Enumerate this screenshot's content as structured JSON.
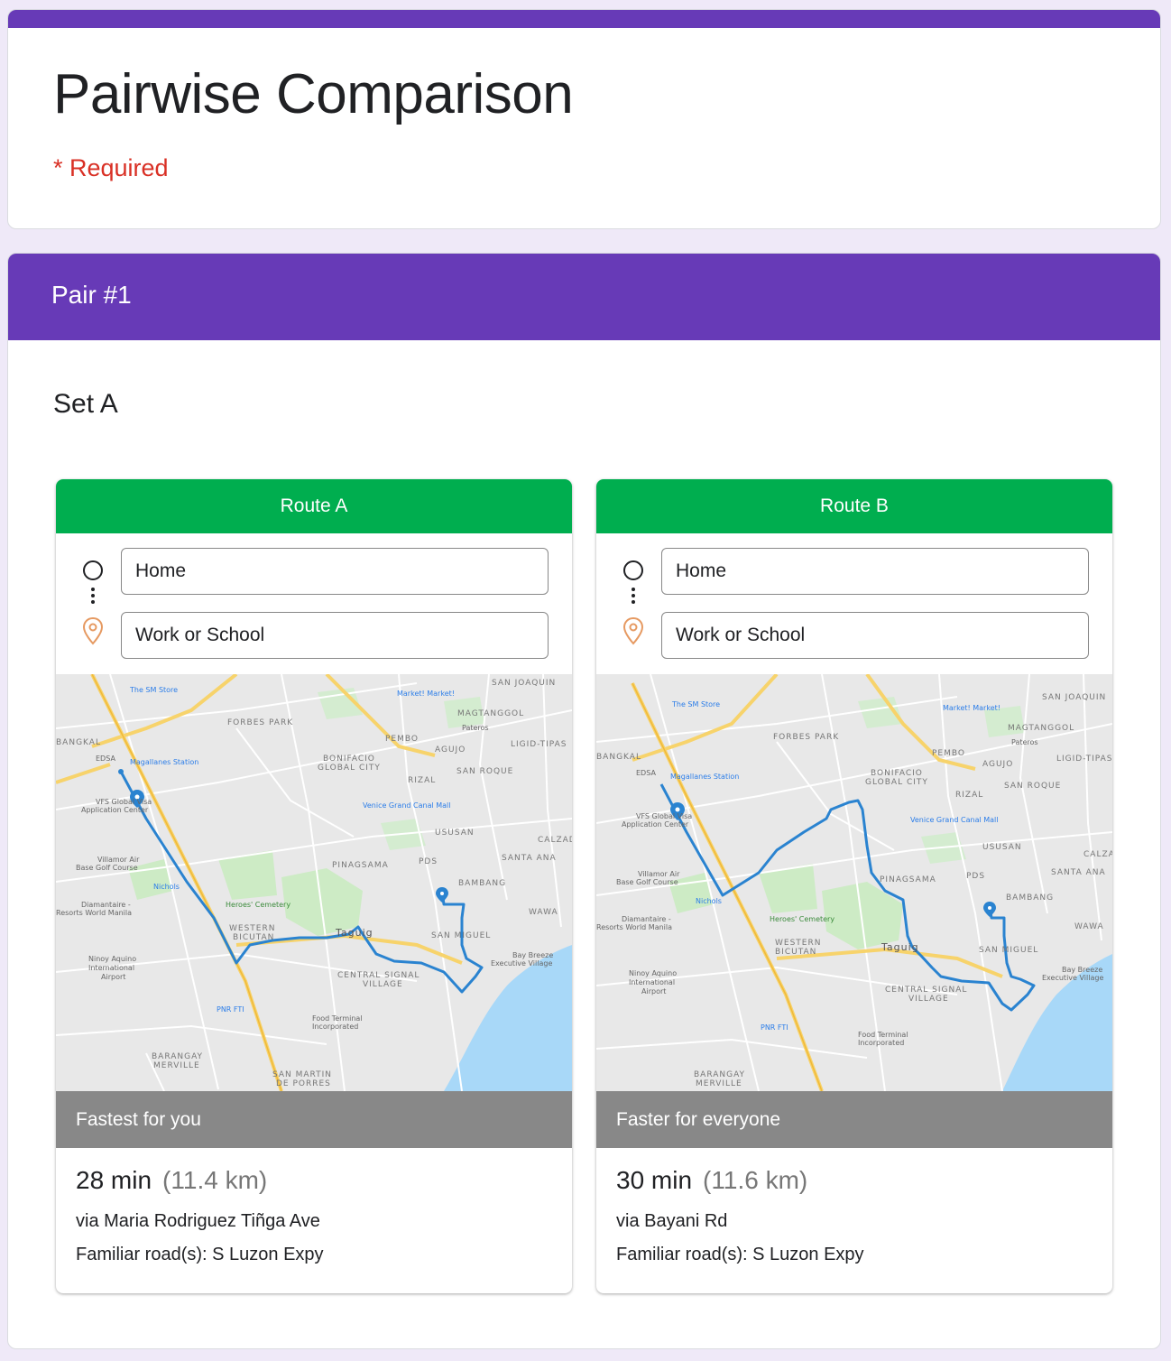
{
  "form": {
    "title": "Pairwise Comparison",
    "required_note": "* Required"
  },
  "section": {
    "header": "Pair #1",
    "set_label": "Set A"
  },
  "routes": [
    {
      "name": "Route A",
      "from": "Home",
      "to": "Work or School",
      "banner": "Fastest for you",
      "time": "28 min",
      "distance": "(11.4 km)",
      "via": "via Maria Rodriguez Tiñga Ave",
      "familiar": "Familiar road(s): S Luzon Expy"
    },
    {
      "name": "Route B",
      "from": "Home",
      "to": "Work or School",
      "banner": "Faster for everyone",
      "time": "30 min",
      "distance": "(11.6 km)",
      "via": "via Bayani Rd",
      "familiar": "Familiar road(s): S Luzon Expy"
    }
  ],
  "map_labels": {
    "forbes_park": "FORBES PARK",
    "bangkal": "BANGKAL",
    "pembo": "PEMBO",
    "agujo": "AGUJO",
    "magtanggol": "MAGTANGGOL",
    "pateros": "Pateros",
    "san_joaquin": "SAN JOAQUIN",
    "bgc_1": "BONIFACIO",
    "bgc_2": "GLOBAL CITY",
    "rizal": "RIZAL",
    "san_roque": "SAN ROQUE",
    "ususan": "USUSAN",
    "pinagsama": "PINAGSAMA",
    "pds": "PDS",
    "bambang": "BAMBANG",
    "santa_ana": "SANTA ANA",
    "western_1": "WESTERN",
    "western_2": "BICUTAN",
    "taguig": "Taguig",
    "san_miguel": "SAN MIGUEL",
    "central_1": "CENTRAL SIGNAL",
    "central_2": "VILLAGE",
    "wawa": "WAWA",
    "naia_1": "Ninoy Aquino",
    "naia_2": "International",
    "naia_3": "Airport",
    "merville_1": "BARANGAY",
    "merville_2": "MERVILLE",
    "sm_store": "The SM Store",
    "market": "Market! Market!",
    "venice": "Venice Grand Canal Mall",
    "heroes": "Heroes' Cemetery",
    "food_terminal_1": "Food Terminal",
    "food_terminal_2": "Incorporated",
    "vfs": "VFS Global Visa",
    "vfs_2": "Application Center",
    "villamor_1": "Villamor Air",
    "villamor_2": "Base Golf Course",
    "diamantaire_1": "Diamantaire -",
    "diamantaire_2": "Resorts World Manila",
    "bay_breeze_1": "Bay Breeze",
    "bay_breeze_2": "Executive Village",
    "magallanes": "Magallanes Station",
    "nichols": "Nichols",
    "pnr_fti": "PNR FTI",
    "san_martin_1": "SAN MARTIN",
    "san_martin_2": "DE PORRES",
    "ligid": "LIGID-TIPAS",
    "calzada": "CALZADA",
    "edsa": "EDSA"
  },
  "colors": {
    "form_accent": "#673ab7",
    "route_header": "#00ae4f",
    "required": "#d93025",
    "route_line": "#2a83d0",
    "banner": "#888888"
  },
  "icons": {
    "origin": "circle-icon",
    "destination": "location-pin-icon"
  }
}
